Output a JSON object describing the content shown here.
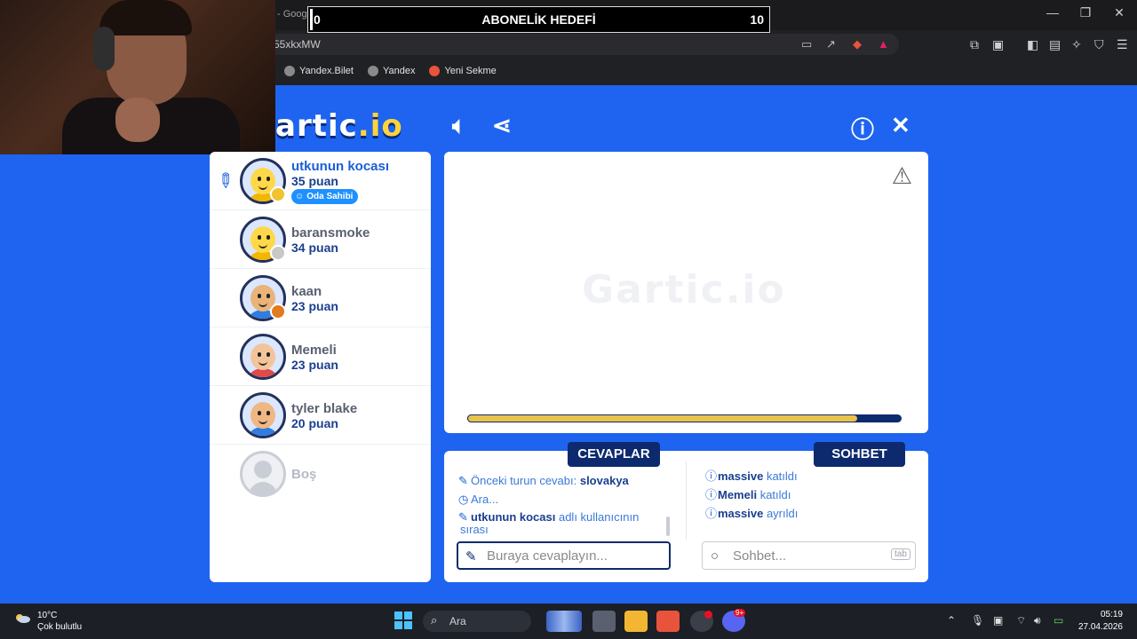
{
  "browser": {
    "tab_title": "- Google'da Ara",
    "url": "55xkxMW",
    "bookmarks": [
      "Yandex.Bilet",
      "Yandex",
      "Yeni Sekme"
    ]
  },
  "overlay": {
    "goal_current": "0",
    "goal_title": "ABONELİK HEDEFİ",
    "goal_target": "10"
  },
  "game": {
    "logo_prefix": "artic",
    "logo_suffix": ".io",
    "players": [
      {
        "name": "utkunun kocası",
        "score": "35 puan",
        "badge": "Oda Sahibi",
        "status_color": "#f2c230",
        "face": "#ffd84a",
        "shirt": "#f2b600"
      },
      {
        "name": "baransmoke",
        "score": "34 puan",
        "status_color": "#c8c8c8",
        "face": "#ffd84a",
        "shirt": "#f2b600"
      },
      {
        "name": "kaan",
        "score": "23 puan",
        "status_color": "#e27a1f",
        "face": "#e9b37a",
        "shirt": "#2f7de1"
      },
      {
        "name": "Memeli",
        "score": "23 puan",
        "status_color": "",
        "face": "#f3c49a",
        "shirt": "#e04a4a"
      },
      {
        "name": "tyler blake",
        "score": "20 puan",
        "status_color": "",
        "face": "#f0b783",
        "shirt": "#2f7de1"
      },
      {
        "name": "Boş",
        "score": ""
      }
    ],
    "canvas_watermark": "Gartic.io",
    "timer_progress": 0.9,
    "answers_tab": "CEVAPLAR",
    "chat_tab": "SOHBET",
    "answers": [
      {
        "icon": "pencil-icon",
        "text": "Önceki turun cevabı: ",
        "bold": "slovakya"
      },
      {
        "icon": "clock-icon",
        "text": "Ara...",
        "bold": ""
      },
      {
        "icon": "pencil-icon",
        "bold": "utkunun kocası",
        "text": " adlı kullanıcının",
        "extra": "sırası"
      }
    ],
    "chat": [
      {
        "bold": "massive",
        "text": " katıldı"
      },
      {
        "bold": "Memeli",
        "text": " katıldı"
      },
      {
        "bold": "massive",
        "text": " ayrıldı"
      }
    ],
    "answer_placeholder": "Buraya cevaplayın...",
    "chat_placeholder": "Sohbet...",
    "chat_key": "tab"
  },
  "taskbar": {
    "temp": "10°C",
    "weather": "Çok bulutlu",
    "search": "Ara",
    "time": "05:19",
    "date": "27.04.2026",
    "discord_badge": "9+"
  },
  "colors": {
    "background": "#1e64f0",
    "dark_navy": "#0d2a6e",
    "timer": "#e7c34a"
  }
}
